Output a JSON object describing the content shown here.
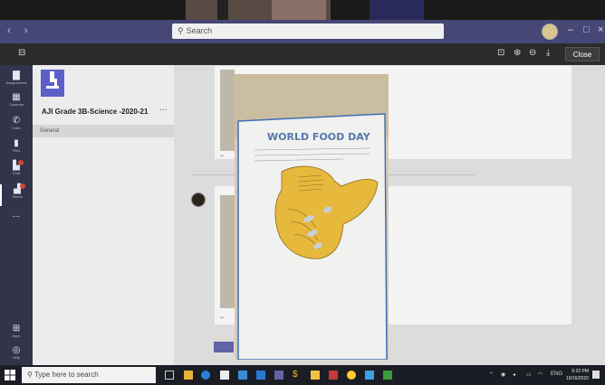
{
  "search": {
    "placeholder": "Search"
  },
  "viewer": {
    "close_label": "Close"
  },
  "rail": {
    "items": [
      {
        "label": "Assignments",
        "icon": "bell-icon"
      },
      {
        "label": "Calendar",
        "icon": "chat-icon"
      },
      {
        "label": "Calls",
        "icon": "phone-icon"
      },
      {
        "label": "Files",
        "icon": "file-icon"
      },
      {
        "label": "Chat",
        "icon": "chat-icon"
      },
      {
        "label": "Teams",
        "icon": "teams-icon"
      },
      {
        "label": "Apps",
        "icon": "apps-icon"
      },
      {
        "label": "Help",
        "icon": "help-icon"
      }
    ],
    "more": "..."
  },
  "team": {
    "name": "AJI Grade 3B-Science -2020-21",
    "more": "···",
    "channel": "General"
  },
  "drawing": {
    "title": "WORLD FOOD DAY"
  },
  "taskbar": {
    "search_placeholder": "Type here to search",
    "lang": "ENG",
    "time": "6:22 PM",
    "date": "10/16/2020"
  },
  "colors": {
    "teams_purple": "#464775",
    "rail": "#33344a",
    "accent": "#6264a7"
  }
}
